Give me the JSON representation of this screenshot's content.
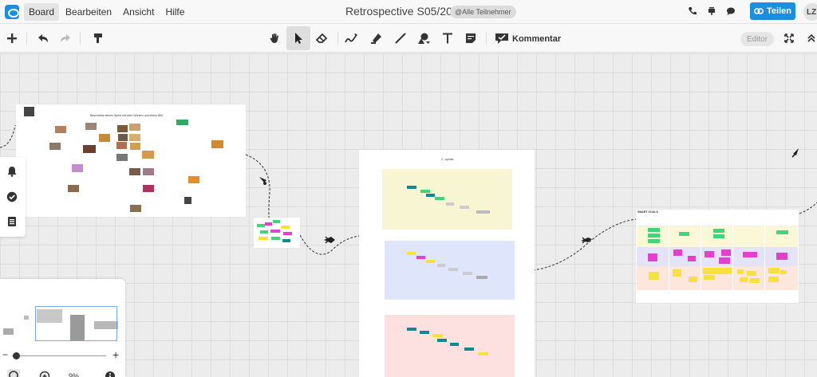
{
  "menu": {
    "items": [
      "Board",
      "Bearbeiten",
      "Ansicht",
      "Hilfe"
    ],
    "active": "Board"
  },
  "board": {
    "title": "Retrospective S05/20",
    "participants_badge": "@Alle Teilnehmer"
  },
  "header": {
    "share_label": "Teilen",
    "avatar_initials": "LZ"
  },
  "toolbar": {
    "comment_label": "Kommentar",
    "editor_label": "Editor"
  },
  "canvas": {
    "collage_title": "Beschreibe deinen Sprint mit zehn Wörtern und einem Bild",
    "sprint_frame_title": "2 - sprints",
    "smart_goals_title": "SMART GOALS"
  },
  "minimap": {
    "zoom_value": "9%"
  },
  "colors": {
    "accent": "#1a8fe0",
    "section_yellow": "#f8f6d2",
    "section_blue": "#dfe5fb",
    "section_red": "#fde0e0",
    "sticky_green": "#3fd57a",
    "sticky_magenta": "#e43fcf",
    "sticky_yellow": "#f7e23a",
    "sticky_teal": "#0f8a93"
  }
}
